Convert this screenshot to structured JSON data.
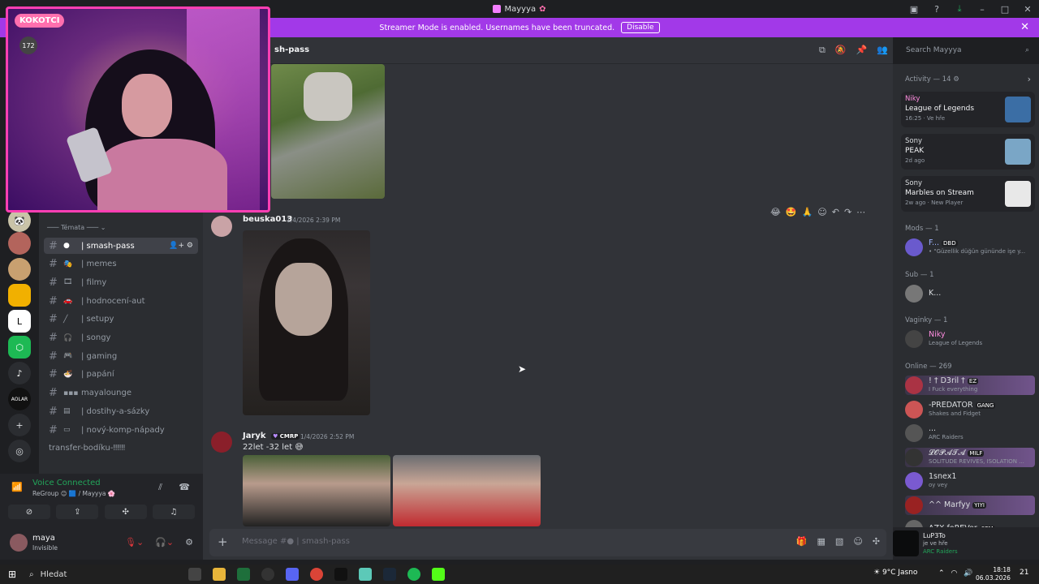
{
  "window": {
    "title": "Mayyya"
  },
  "banner": {
    "text": "Streamer Mode is enabled. Usernames have been truncated.",
    "button": "Disable"
  },
  "channel_header": {
    "name": "sh-pass"
  },
  "search": {
    "placeholder": "Search Mayyya"
  },
  "channels": {
    "category": "Témata",
    "items": [
      {
        "emoji": "●",
        "label": "| smash-pass",
        "active": true
      },
      {
        "emoji": "🎭",
        "label": "| memes"
      },
      {
        "emoji": "🎞",
        "label": "| filmy"
      },
      {
        "emoji": "🚗",
        "label": "| hodnocení-aut"
      },
      {
        "emoji": "╱",
        "label": "| setupy"
      },
      {
        "emoji": "🎧",
        "label": "| songy"
      },
      {
        "emoji": "🎮",
        "label": "| gaming"
      },
      {
        "emoji": "🍜",
        "label": "| papání"
      },
      {
        "emoji": "▪▪▪",
        "label": "mayalounge"
      },
      {
        "emoji": "▤",
        "label": "| dostihy-a-sázky"
      },
      {
        "emoji": "▭",
        "label": "| nový-komp-nápady"
      },
      {
        "emoji": "",
        "label": "transfer-bodíku-‼‼‼"
      }
    ]
  },
  "voice": {
    "status": "Voice Connected",
    "sub": "ReGroup 😊 🟦 / Mayyya 🌸"
  },
  "user": {
    "name": "maya",
    "status": "Invisible"
  },
  "messages": [
    {
      "author": "beuska013",
      "time": "1/4/2026 2:39 PM"
    },
    {
      "author": "Jaryk",
      "badge": "CMRP",
      "time": "1/4/2026 2:52 PM",
      "text": "22let -32 let 😅"
    }
  ],
  "composer": {
    "placeholder": "Message #● | smash-pass"
  },
  "members": {
    "activity_header": "Activity — 14",
    "activities": [
      {
        "who": "Niky",
        "game": "League of Legends",
        "meta": "16:25 · Ve hře",
        "color": "#3b6ea5"
      },
      {
        "who": "Sony",
        "game": "PEAK",
        "meta": "2d ago",
        "color": "#7aa6c6"
      },
      {
        "who": "Sony",
        "game": "Marbles on Stream",
        "meta": "2w ago · New Player",
        "color": "#e8e8e8"
      }
    ],
    "mods_header": "Mods — 1",
    "mods": [
      {
        "name": "F...",
        "tag": "DBD",
        "sub": "• \"Güzellik düğün gününde işe y..."
      }
    ],
    "sub_header": "Sub — 1",
    "subs": [
      {
        "name": "K..."
      }
    ],
    "vaginky_header": "Vaginky — 1",
    "vaginky": [
      {
        "name": "Niky",
        "sub": "League of Legends"
      }
    ],
    "online_header": "Online — 269",
    "online": [
      {
        "name": "! † D3ril †",
        "tag": "EZ",
        "sub": "I Fuck everything"
      },
      {
        "name": "-PREDATOR",
        "tag": "GANG",
        "sub": "Shakes and Fidget"
      },
      {
        "name": "...",
        "tag": "",
        "sub": "ARC Raiders"
      },
      {
        "name": "𝓛𝓞𝓟𝓐𝓣𝓐",
        "tag": "MILF",
        "sub": "SOLITUDE REVIVES, ISOLATION ..."
      },
      {
        "name": "1snex1",
        "tag": "",
        "sub": "oy vey"
      },
      {
        "name": "^^ Marfyy",
        "tag": "YIYI",
        "sub": ""
      },
      {
        "name": "AZX foREVer",
        "tag": "SEM",
        "sub": ""
      }
    ]
  },
  "now_playing": {
    "name": "LuP3To",
    "status": "je ve hře",
    "game": "ARC Raiders"
  },
  "webcam": {
    "logo": "KOKOTCI",
    "count": "172"
  },
  "taskbar": {
    "search": "Hledat",
    "weather": "9°C Jasno",
    "time": "18:18",
    "date": "06.03.2026",
    "notif": "21"
  }
}
